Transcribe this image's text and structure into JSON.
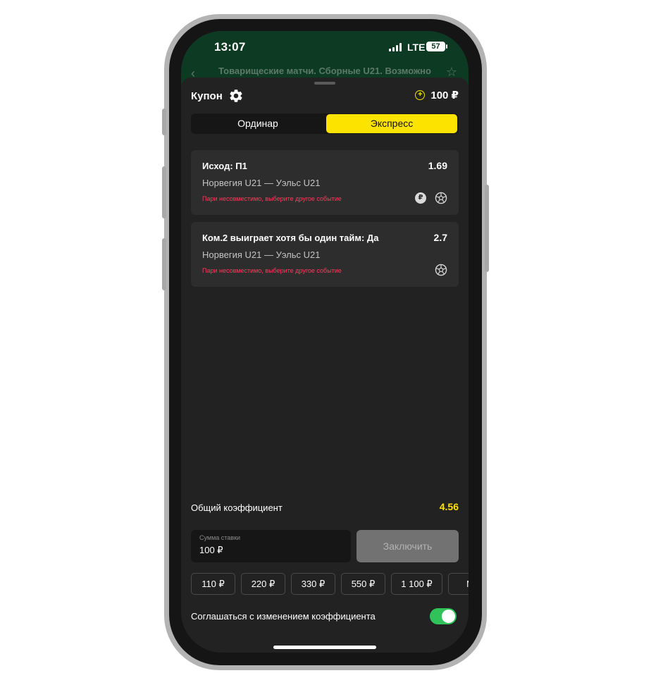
{
  "status_bar": {
    "time": "13:07",
    "network": "LTE",
    "battery": "57"
  },
  "background": {
    "title": "Товарищеские матчи. Сборные U21. Возможно"
  },
  "coupon": {
    "title": "Купон",
    "balance": "100 ₽",
    "tabs": [
      {
        "label": "Ординар",
        "active": false
      },
      {
        "label": "Экспресс",
        "active": true
      }
    ]
  },
  "bets": [
    {
      "title": "Исход: П1",
      "odds": "1.69",
      "match": "Норвегия U21 — Уэльс U21",
      "error": "Пари несовместимо, выберите другое событие",
      "badge": "₽",
      "icons": [
        "ruble-icon",
        "soccer-ball-icon"
      ]
    },
    {
      "title": "Ком.2 выиграет хотя бы один тайм: Да",
      "odds": "2.7",
      "match": "Норвегия U21 — Уэльс U21",
      "error": "Пари несовместимо, выберите другое событие",
      "icons": [
        "soccer-ball-icon"
      ]
    }
  ],
  "summary": {
    "total_odds_label": "Общий коэффициент",
    "total_odds_value": "4.56"
  },
  "stake": {
    "label": "Сумма ставки",
    "value": "100 ₽",
    "submit_label": "Заключить"
  },
  "quick_amounts": [
    "110 ₽",
    "220 ₽",
    "330 ₽",
    "550 ₽",
    "1 100 ₽",
    "M"
  ],
  "agree": {
    "label": "Соглашаться с изменением коэффициента",
    "enabled": true
  },
  "colors": {
    "accent": "#fde300",
    "error": "#ff3b5c",
    "toggle_on": "#2fc35a",
    "header_bg": "#0d3a22",
    "sheet_bg": "#222222"
  }
}
